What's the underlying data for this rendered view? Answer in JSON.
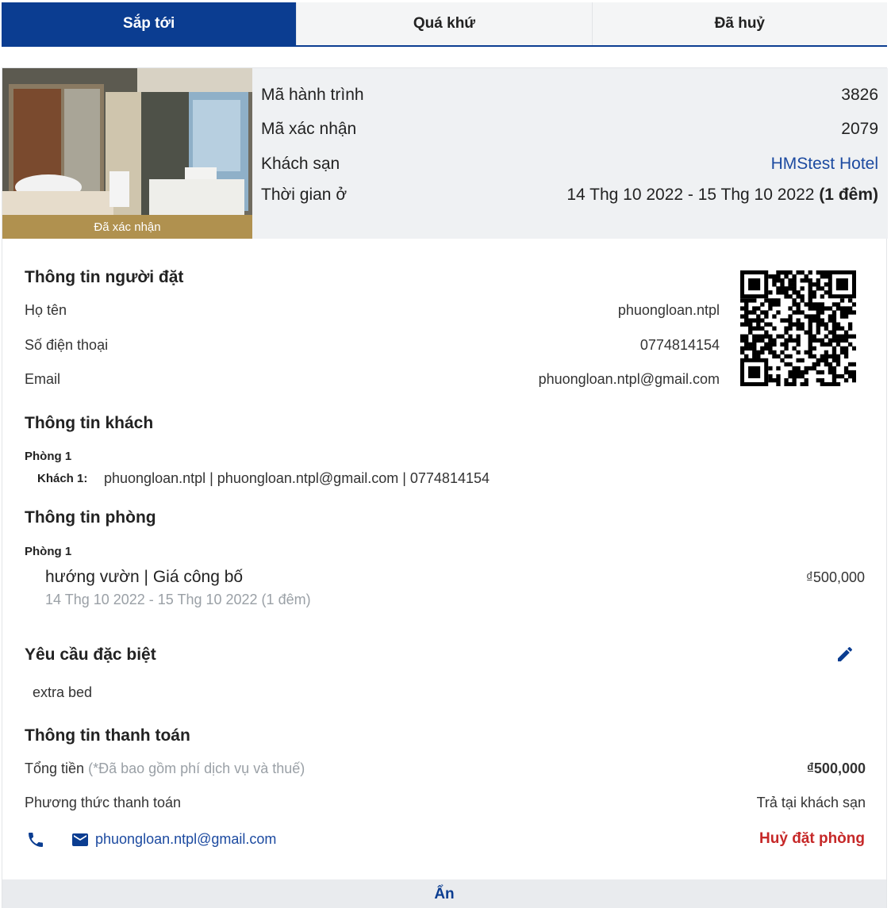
{
  "tabs": [
    {
      "label": "Sắp tới",
      "active": true
    },
    {
      "label": "Quá khứ",
      "active": false
    },
    {
      "label": "Đã huỷ",
      "active": false
    }
  ],
  "booking": {
    "status_badge": "Đã xác nhận",
    "itinerary_label": "Mã hành trình",
    "itinerary_value": "3826",
    "confirmation_label": "Mã xác nhận",
    "confirmation_value": "2079",
    "hotel_label": "Khách sạn",
    "hotel_value": "HMStest Hotel",
    "stay_label": "Thời gian ở",
    "stay_dates": "14 Thg 10 2022 - 15 Thg 10 2022",
    "stay_nights": "(1 đêm)"
  },
  "booker": {
    "title": "Thông tin người đặt",
    "name_label": "Họ tên",
    "name_value": "phuongloan.ntpl",
    "phone_label": "Số điện thoại",
    "phone_value": "0774814154",
    "email_label": "Email",
    "email_value": "phuongloan.ntpl@gmail.com"
  },
  "guests": {
    "title": "Thông tin khách",
    "room_label": "Phòng 1",
    "guest_label": "Khách 1:",
    "guest_value": "phuongloan.ntpl | phuongloan.ntpl@gmail.com | 0774814154"
  },
  "rooms": {
    "title": "Thông tin phòng",
    "room_label": "Phòng 1",
    "room_name": "hướng vườn | Giá công bố",
    "room_dates": "14 Thg 10 2022 - 15 Thg 10 2022 (1 đêm)",
    "room_price": "₫500,000"
  },
  "special": {
    "title": "Yêu cầu đặc biệt",
    "text": "extra bed",
    "edit_icon": "pencil-icon"
  },
  "payment": {
    "title": "Thông tin thanh toán",
    "total_label": "Tổng tiền",
    "total_note": "(*Đã bao gồm phí dịch vụ và thuế)",
    "total_value": "₫500,000",
    "method_label": "Phương thức thanh toán",
    "method_value": "Trả tại khách sạn"
  },
  "contact": {
    "phone_icon": "phone-icon",
    "mail_icon": "mail-icon",
    "email": "phuongloan.ntpl@gmail.com"
  },
  "actions": {
    "cancel_label": "Huỷ đặt phòng",
    "hide_label": "Ẩn"
  },
  "colors": {
    "primary": "#0b3d91",
    "badge_gold": "#b0914f",
    "link_blue": "#1c4aa0",
    "danger": "#c62828",
    "summary_bg": "#eff1f3"
  }
}
